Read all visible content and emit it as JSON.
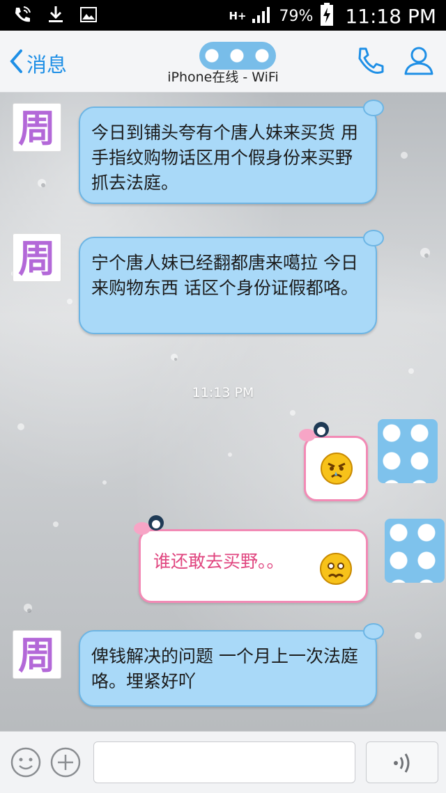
{
  "status_bar": {
    "network": "H+",
    "battery_percent": "79%",
    "time": "11:18 PM",
    "icons": [
      "phone-wifi-icon",
      "download-icon",
      "gallery-icon",
      "signal-icon",
      "battery-charging-icon"
    ]
  },
  "header": {
    "back_label": "消息",
    "subtitle": "iPhone在线 - WiFi",
    "icons": [
      "call-icon",
      "profile-icon"
    ]
  },
  "chat": {
    "contact_avatar_char": "周",
    "messages": [
      {
        "from": "contact",
        "text": "今日到铺头夸有个唐人妹来买货 用手指纹购物话区用个假身份来买野 抓去法庭。"
      },
      {
        "from": "contact",
        "text": "宁个唐人妹已经翻都唐来噶拉 今日来购物东西 话区个身份证假都咯。"
      },
      {
        "from": "me",
        "emoji": "angry-face-emoji"
      },
      {
        "from": "me",
        "text": "谁还敢去买野。。",
        "emoji": "worried-face-emoji"
      },
      {
        "from": "contact",
        "text": "俾钱解决的问题 一个月上一次法庭咯。埋紧好吖"
      }
    ],
    "timestamp": "11:13 PM"
  },
  "input_bar": {
    "placeholder": "",
    "icons": [
      "emoji-icon",
      "plus-icon",
      "voice-icon"
    ]
  },
  "colors": {
    "accent": "#1e8fe6",
    "incoming_bubble": "#a9d9f8",
    "outgoing_border": "#f28ab5",
    "outgoing_text": "#e0457f"
  }
}
